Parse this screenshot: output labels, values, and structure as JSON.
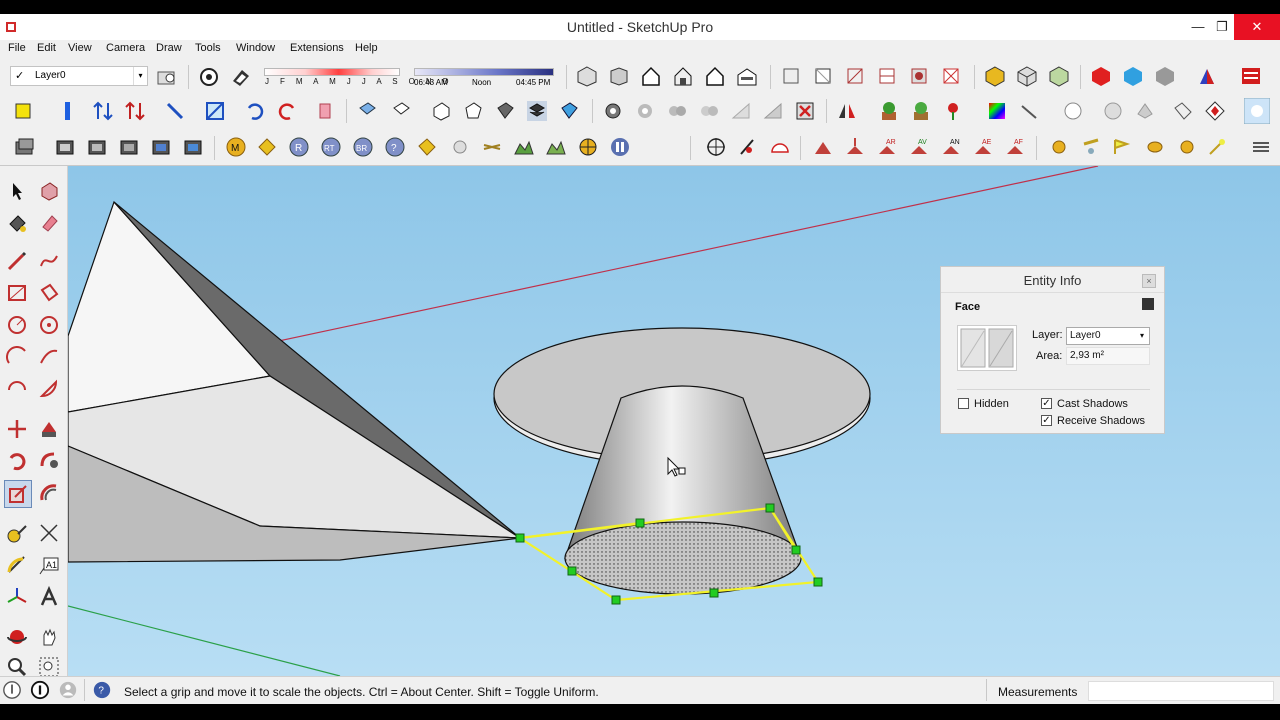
{
  "window": {
    "title": "Untitled - SketchUp Pro",
    "minimize": "—",
    "maximize": "❐",
    "close": "✕"
  },
  "menu": [
    "File",
    "Edit",
    "View",
    "Camera",
    "Draw",
    "Tools",
    "Window",
    "Extensions",
    "Help"
  ],
  "layer_toolbar": {
    "checkmark": "✓",
    "current_layer": "Layer0",
    "arrow": "▾"
  },
  "shadows": {
    "months": "J F M A M J J A S O N D",
    "time_start": "06:43 AM",
    "time_mid": "Noon",
    "time_end": "04:45 PM"
  },
  "entity_info": {
    "title": "Entity Info",
    "close": "×",
    "type": "Face",
    "layer_label": "Layer:",
    "layer_value": "Layer0",
    "area_label": "Area:",
    "area_value": "2,93 m²",
    "hidden_label": "Hidden",
    "hidden_checked": false,
    "cast_label": "Cast Shadows",
    "cast_checked": true,
    "receive_label": "Receive Shadows",
    "receive_checked": true,
    "checkmark": "✓"
  },
  "status": {
    "message": "Select a grip and move it to scale the objects. Ctrl = About Center. Shift = Toggle Uniform.",
    "measurements_label": "Measurements",
    "measurements_value": "",
    "info_icon": "?"
  },
  "colors": {
    "sky": "#8ec6e8",
    "selection": "#f2f22a",
    "grip": "#22cc22",
    "red_axis": "#c0304a",
    "green_axis": "#2aa048"
  }
}
